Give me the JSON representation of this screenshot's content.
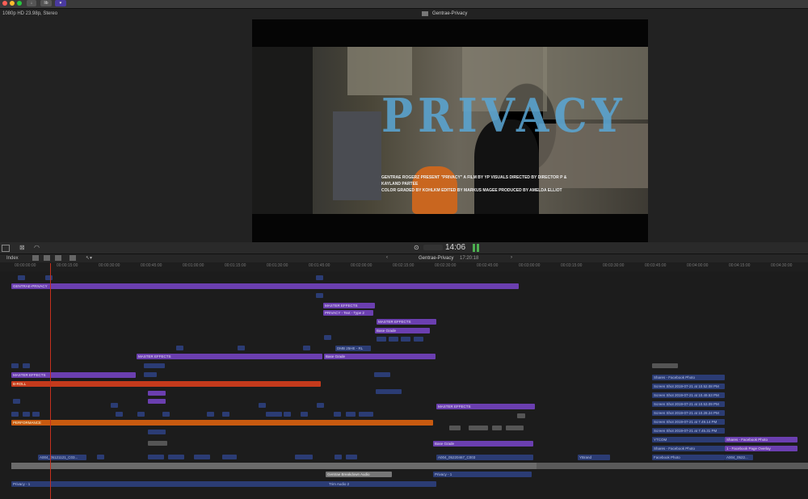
{
  "window": {
    "title": "Gentrae-Privacy",
    "format": "1080p HD 23.98p, Stereo",
    "colors": {
      "close": "#ff5f57",
      "minimize": "#febc2e",
      "zoom": "#28c840",
      "accent": "#6b3fb0"
    }
  },
  "toolbar_buttons": {
    "import": "↓",
    "library": "lib",
    "heart": "♥"
  },
  "video": {
    "title_text": "PRIVACY",
    "credits_line1": "GENTRAE ROGERZ  PRESENT  \"PRIVACY\"  A FILM BY  YP VISUALS  DIRECTED BY  DIRECTOR P & KAYLAND PARTEE",
    "credits_line2": "COLOR GRADED BY KOHLKM    EDITED BY MARKUS MAGEE    PRODUCED BY  AMELDA ELLIOT"
  },
  "playback": {
    "timecode": "14:06"
  },
  "timeline": {
    "index_label": "Index",
    "project_name": "Gentrae-Privacy",
    "duration": "17:20:18",
    "ruler_ticks": [
      "00:00:00:00",
      "00:00:15:00",
      "00:00:30:00",
      "00:00:45:00",
      "00:01:00:00",
      "00:01:15:00",
      "00:01:30:00",
      "00:01:45:00",
      "00:02:00:00",
      "00:02:15:00",
      "00:02:30:00",
      "00:02:45:00",
      "00:03:00:00",
      "00:03:15:00",
      "00:03:30:00",
      "00:03:45:00",
      "00:04:00:00",
      "00:04:15:00",
      "00:04:30:00"
    ]
  },
  "clips": {
    "gentrae": "GENTRAE-PRIVACY",
    "master1": "MASTER EFFECTS",
    "privacy_title": "PRIVACY - Text - Type 2",
    "master2": "MASTER EFFECTS",
    "base_grade1": "Base Grade",
    "dmb": "DMB 25HE - RL",
    "master3": "MASTER EFFECTS",
    "base_grade2": "Base Grade",
    "master4": "MASTER EFFECTS",
    "broll": "B-ROLL",
    "performance": "PERFORMANCE",
    "master5": "MASTER EFFECTS",
    "base_grade3": "Base Grade",
    "a004_1": "A004_05121121_C03...",
    "a004_2": "A004_05220467_C003",
    "a004_3": "A004_0522...",
    "audio1": "Gentrae Breakdown Audio",
    "audio2": "Privacy - 1",
    "audio3": "Privacy - 1",
    "audio4": "Trim Audio 2",
    "right_shares1": "Shares - Facebook Photo",
    "ss1": "Screen Shot 2019-07-21 at 10.52.08 PM",
    "ss2": "Screen Shot 2019-07-21 at 10.49.53 PM",
    "ss3": "Screen Shot 2019-07-21 at 10.53.09 PM",
    "ss4": "Screen Shot 2019-07-21 at 10.28.24 PM",
    "ss5": "Screen Shot 2019-07-21 at 7.49.14 PM",
    "ss6": "Screen Shot 2019-07-21 at 7.45.31 PM",
    "right_ytcom": "YTCOM",
    "right_shares2": "Shares - Facebook Photo",
    "right_shares3": "Shares - Facebook Photo",
    "right_fbpage": "1 - Facebook Page Overlay",
    "right_fbphoto": "Facebook Photo",
    "right_ybrand": "YBrand"
  }
}
